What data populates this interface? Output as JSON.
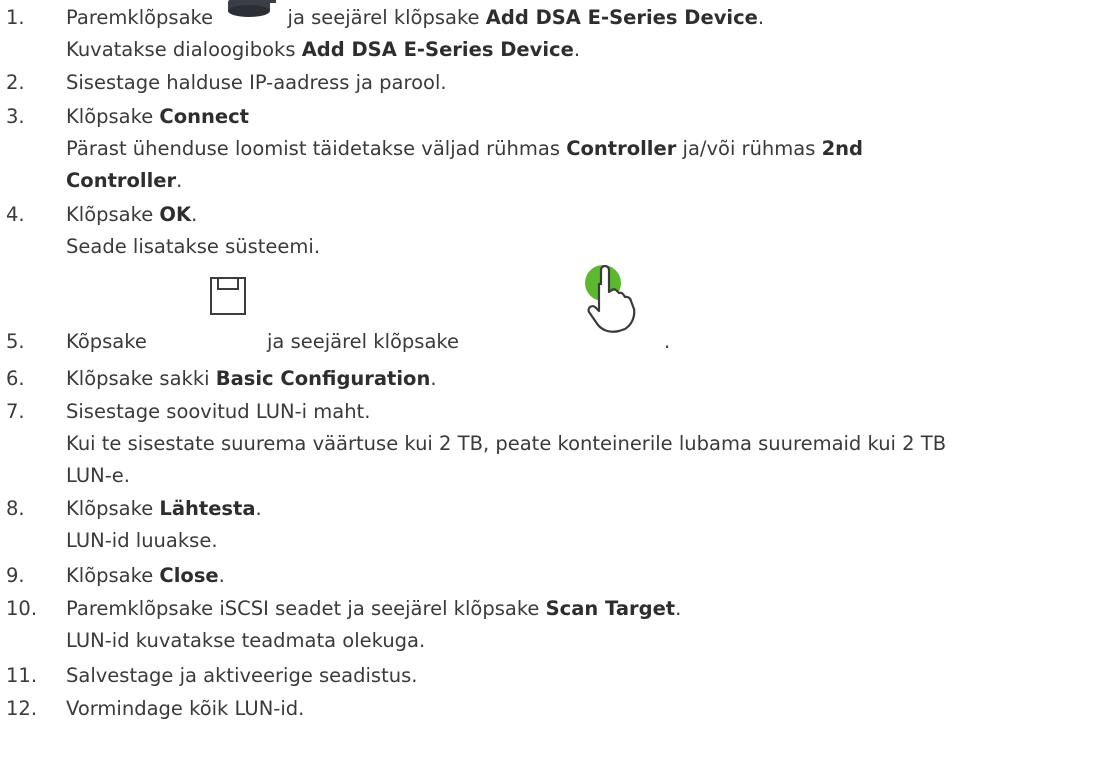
{
  "steps": [
    {
      "num": "1.",
      "l1a": "Paremklõpsake",
      "l1b": "ja seejärel klõpsake",
      "l1c": "Add DSA E-Series Device",
      "l1d": ".",
      "l2a": "Kuvatakse dialoogiboks",
      "l2b": "Add DSA E-Series Device",
      "l2c": "."
    },
    {
      "num": "2.",
      "l1": "Sisestage halduse IP-aadress ja parool."
    },
    {
      "num": "3.",
      "l1a": "Klõpsake",
      "l1b": "Connect",
      "l2a": "Pärast ühenduse loomist täidetakse väljad rühmas",
      "l2b": "Controller",
      "l2c": "ja/või rühmas",
      "l2d": "2nd",
      "l3a": "Controller",
      "l3b": "."
    },
    {
      "num": "4.",
      "l1a": "Klõpsake",
      "l1b": "OK",
      "l1c": ".",
      "l2": "Seade lisatakse süsteemi."
    },
    {
      "num": "5.",
      "l1a": "Kõpsake",
      "l1b": "ja seejärel klõpsake",
      "l1c": "."
    },
    {
      "num": "6.",
      "l1a": "Klõpsake sakki",
      "l1b": "Basic Configuration",
      "l1c": "."
    },
    {
      "num": "7.",
      "l1": "Sisestage soovitud LUN-i maht.",
      "l2": "Kui te sisestate suurema väärtuse kui 2 TB, peate konteinerile lubama suuremaid kui 2 TB",
      "l3": "LUN-e."
    },
    {
      "num": "8.",
      "l1a": "Klõpsake",
      "l1b": "Lähtesta",
      "l1c": ".",
      "l2": "LUN-id luuakse."
    },
    {
      "num": "9.",
      "l1a": "Klõpsake",
      "l1b": "Close",
      "l1c": "."
    },
    {
      "num": "10.",
      "l1a": "Paremklõpsake iSCSI seadet ja seejärel klõpsake",
      "l1b": "Scan Target",
      "l1c": ".",
      "l2": "LUN-id kuvatakse teadmata olekuga."
    },
    {
      "num": "11.",
      "l1": "Salvestage ja aktiveerige seadistus."
    },
    {
      "num": "12.",
      "l1": "Vormindage kõik LUN-id."
    }
  ],
  "icons": {
    "device": "storage-device-icon",
    "save": "save-icon",
    "activate": "activate-hand-icon"
  },
  "colors": {
    "text": "#3a3a3a",
    "activate_green": "#5cb82e"
  }
}
